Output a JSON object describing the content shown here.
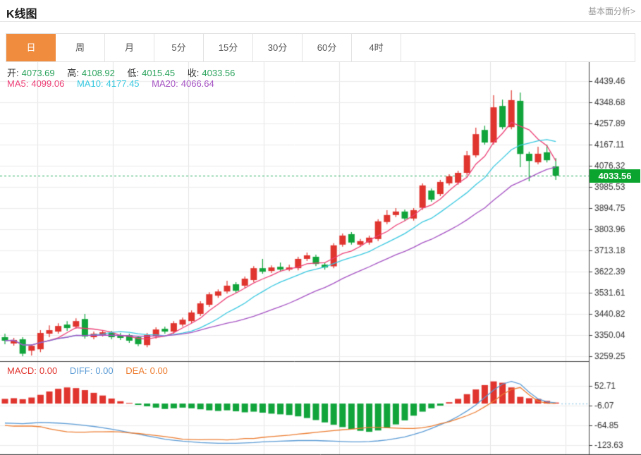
{
  "header": {
    "title": "K线图",
    "link": "基本面分析>"
  },
  "tabs": [
    {
      "key": "daily",
      "label": "日",
      "active": true
    },
    {
      "key": "weekly",
      "label": "周",
      "active": false
    },
    {
      "key": "monthly",
      "label": "月",
      "active": false
    },
    {
      "key": "5min",
      "label": "5分",
      "active": false
    },
    {
      "key": "15min",
      "label": "15分",
      "active": false
    },
    {
      "key": "30min",
      "label": "30分",
      "active": false
    },
    {
      "key": "60min",
      "label": "60分",
      "active": false
    },
    {
      "key": "4hour",
      "label": "4时",
      "active": false
    }
  ],
  "ohlc_legend": {
    "open_label": "开:",
    "open": "4073.69",
    "high_label": "高:",
    "high": "4108.92",
    "low_label": "低:",
    "low": "4015.45",
    "close_label": "收:",
    "close": "4033.56"
  },
  "ma_legend": {
    "ma5_label": "MA5:",
    "ma5": "4099.06",
    "ma10_label": "MA10:",
    "ma10": "4177.45",
    "ma20_label": "MA20:",
    "ma20": "4066.64"
  },
  "macd_legend": {
    "macd_label": "MACD:",
    "macd": "0.00",
    "diff_label": "DIFF:",
    "diff": "0.00",
    "dea_label": "DEA:",
    "dea": "0.00"
  },
  "price_tag": "4033.56",
  "colors": {
    "up_red": "#e0342e",
    "down_green": "#10a43b",
    "ma5": "#ed3f76",
    "ma10": "#36c8e0",
    "ma20": "#a552c3",
    "diff_blue": "#5b9bd5",
    "dea_orange": "#ed7d31",
    "tag_green": "#0aa42e",
    "dotted_price": "#27ae60",
    "dotted_macd": "#9fd0e8",
    "grid": "#ececec",
    "vgrid": "#e4e4e4",
    "axis_dark": "#444444",
    "axis_text": "#333333",
    "tab_active": "#f08c3e"
  },
  "chart_data": {
    "type": "candlestick+macd",
    "main": {
      "y_tick_labels": [
        "4439.46",
        "4348.68",
        "4257.89",
        "4167.11",
        "4076.32",
        "3985.53",
        "3894.75",
        "3803.96",
        "3713.18",
        "3622.39",
        "3531.61",
        "3440.82",
        "3350.04",
        "3259.25"
      ],
      "ylim": [
        3259.25,
        4439.46
      ],
      "current_price": 4033.56,
      "ma_periods": [
        5,
        10,
        20
      ],
      "candles_format": [
        "open",
        "high",
        "low",
        "close"
      ],
      "candles": [
        [
          3341,
          3356,
          3311,
          3326
        ],
        [
          3314,
          3338,
          3305,
          3329
        ],
        [
          3332,
          3341,
          3259,
          3270
        ],
        [
          3283,
          3311,
          3262,
          3304
        ],
        [
          3289,
          3371,
          3277,
          3359
        ],
        [
          3356,
          3392,
          3341,
          3371
        ],
        [
          3365,
          3401,
          3356,
          3389
        ],
        [
          3395,
          3410,
          3368,
          3380
        ],
        [
          3386,
          3422,
          3377,
          3410
        ],
        [
          3419,
          3441,
          3335,
          3344
        ],
        [
          3341,
          3365,
          3332,
          3356
        ],
        [
          3350,
          3371,
          3344,
          3362
        ],
        [
          3359,
          3368,
          3332,
          3341
        ],
        [
          3350,
          3359,
          3329,
          3338
        ],
        [
          3350,
          3356,
          3317,
          3326
        ],
        [
          3341,
          3347,
          3302,
          3311
        ],
        [
          3307,
          3359,
          3298,
          3350
        ],
        [
          3344,
          3383,
          3335,
          3374
        ],
        [
          3377,
          3386,
          3356,
          3365
        ],
        [
          3365,
          3410,
          3356,
          3401
        ],
        [
          3395,
          3425,
          3386,
          3416
        ],
        [
          3410,
          3456,
          3401,
          3447
        ],
        [
          3441,
          3495,
          3432,
          3486
        ],
        [
          3480,
          3534,
          3471,
          3525
        ],
        [
          3519,
          3546,
          3510,
          3537
        ],
        [
          3537,
          3583,
          3528,
          3562
        ],
        [
          3568,
          3577,
          3531,
          3540
        ],
        [
          3562,
          3601,
          3553,
          3592
        ],
        [
          3586,
          3646,
          3577,
          3637
        ],
        [
          3637,
          3677,
          3613,
          3622
        ],
        [
          3625,
          3649,
          3616,
          3640
        ],
        [
          3643,
          3661,
          3622,
          3631
        ],
        [
          3631,
          3652,
          3625,
          3640
        ],
        [
          3637,
          3686,
          3628,
          3677
        ],
        [
          3677,
          3704,
          3668,
          3692
        ],
        [
          3686,
          3695,
          3646,
          3655
        ],
        [
          3652,
          3661,
          3631,
          3640
        ],
        [
          3645,
          3744,
          3637,
          3735
        ],
        [
          3738,
          3786,
          3729,
          3777
        ],
        [
          3783,
          3792,
          3738,
          3747
        ],
        [
          3738,
          3762,
          3729,
          3753
        ],
        [
          3747,
          3777,
          3738,
          3768
        ],
        [
          3762,
          3847,
          3753,
          3838
        ],
        [
          3835,
          3886,
          3826,
          3865
        ],
        [
          3865,
          3895,
          3856,
          3880
        ],
        [
          3880,
          3889,
          3841,
          3850
        ],
        [
          3850,
          3895,
          3841,
          3886
        ],
        [
          3896,
          4001,
          3887,
          3992
        ],
        [
          3970,
          3979,
          3922,
          3931
        ],
        [
          3955,
          4016,
          3946,
          4007
        ],
        [
          4001,
          4040,
          3992,
          4031
        ],
        [
          4004,
          4055,
          3995,
          4046
        ],
        [
          4046,
          4140,
          4037,
          4121
        ],
        [
          4121,
          4240,
          4112,
          4212
        ],
        [
          4230,
          4248,
          4167,
          4176
        ],
        [
          4176,
          4379,
          4167,
          4327
        ],
        [
          4333,
          4360,
          4233,
          4242
        ],
        [
          4242,
          4400,
          4233,
          4358
        ],
        [
          4355,
          4390,
          4070,
          4127
        ],
        [
          4128,
          4137,
          4010,
          4097
        ],
        [
          4091,
          4158,
          4082,
          4128
        ],
        [
          4134,
          4167,
          4091,
          4100
        ],
        [
          4073.69,
          4108.92,
          4015.45,
          4033.56
        ]
      ]
    },
    "macd": {
      "y_tick_labels": [
        "52.71",
        "-6.07",
        "-64.85",
        "-123.63"
      ],
      "y_ticks": [
        52.71,
        -6.07,
        -64.85,
        -123.63
      ],
      "hist": [
        14,
        16,
        13,
        18,
        26,
        36,
        44,
        48,
        46,
        40,
        32,
        24,
        15,
        7,
        2,
        -4,
        -8,
        -12,
        -16,
        -14,
        -12,
        -14,
        -17,
        -20,
        -22,
        -20,
        -23,
        -26,
        -24,
        -27,
        -30,
        -32,
        -34,
        -38,
        -43,
        -49,
        -56,
        -63,
        -70,
        -76,
        -81,
        -84,
        -80,
        -72,
        -62,
        -50,
        -36,
        -24,
        -14,
        -6,
        4,
        14,
        28,
        42,
        55,
        66,
        62,
        48,
        20,
        16,
        14,
        8,
        3
      ],
      "diff": [
        -58,
        -59,
        -60,
        -58,
        -56,
        -57,
        -58,
        -60,
        -62,
        -65,
        -68,
        -72,
        -76,
        -81,
        -86,
        -91,
        -96,
        -101,
        -106,
        -109,
        -112,
        -114,
        -116,
        -117,
        -118,
        -118,
        -118,
        -117,
        -116,
        -114,
        -113,
        -112,
        -111,
        -110,
        -110,
        -110,
        -111,
        -112,
        -113,
        -114,
        -114,
        -113,
        -111,
        -108,
        -104,
        -99,
        -92,
        -84,
        -74,
        -63,
        -52,
        -38,
        -22,
        -4,
        18,
        40,
        58,
        66,
        58,
        34,
        14,
        5,
        2
      ],
      "dea": [
        -65,
        -67,
        -66.5,
        -67,
        -69,
        -75,
        -80,
        -84,
        -85,
        -85,
        -84,
        -84,
        -83.5,
        -84.5,
        -87,
        -89,
        -92,
        -95,
        -98,
        -102,
        -106,
        -107,
        -107.5,
        -107,
        -107,
        -108,
        -106.5,
        -104,
        -104,
        -100.5,
        -98,
        -96,
        -94,
        -91,
        -88.5,
        -85.5,
        -83,
        -80.5,
        -78,
        -76,
        -73.5,
        -71,
        -71,
        -72,
        -73,
        -74,
        -74,
        -72,
        -67,
        -60,
        -54,
        -45,
        -36,
        -25,
        -9.5,
        7,
        27,
        42,
        48,
        26,
        7,
        1,
        0.5
      ]
    }
  }
}
